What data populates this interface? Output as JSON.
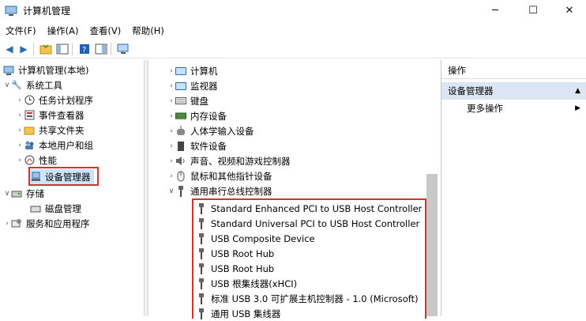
{
  "window": {
    "title": "计算机管理",
    "min": "─",
    "max": "☐",
    "close": "✕"
  },
  "menu": [
    "文件(F)",
    "操作(A)",
    "查看(V)",
    "帮助(H)"
  ],
  "left_tree": {
    "root": "计算机管理(本地)",
    "system_tools": "系统工具",
    "system_children": [
      "任务计划程序",
      "事件查看器",
      "共享文件夹",
      "本地用户和组",
      "性能",
      "设备管理器"
    ],
    "storage": "存储",
    "storage_children": [
      "磁盘管理"
    ],
    "services": "服务和应用程序"
  },
  "device_categories": [
    "计算机",
    "监视器",
    "键盘",
    "内存设备",
    "人体学输入设备",
    "软件设备",
    "声音、视频和游戏控制器",
    "鼠标和其他指针设备",
    "通用串行总线控制器"
  ],
  "usb_devices": [
    "Standard Enhanced PCI to USB Host Controller",
    "Standard Universal PCI to USB Host Controller",
    "USB Composite Device",
    "USB Root Hub",
    "USB Root Hub",
    "USB 根集线器(xHCI)",
    "标准 USB 3.0 可扩展主机控制器 - 1.0 (Microsoft)",
    "通用 USB 集线器"
  ],
  "actions": {
    "header": "操作",
    "selected": "设备管理器",
    "more": "更多操作"
  },
  "colors": {
    "highlight_border": "#d0342c",
    "selection_bg": "#dbe5f3"
  }
}
